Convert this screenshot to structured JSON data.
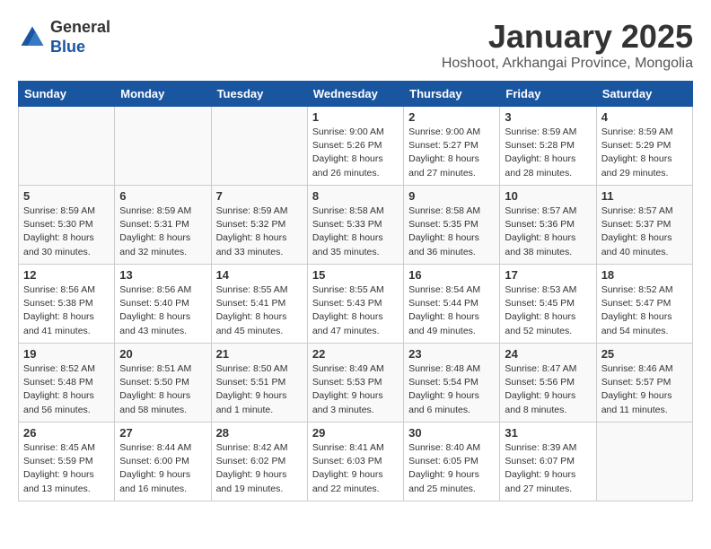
{
  "header": {
    "logo_line1": "General",
    "logo_line2": "Blue",
    "month": "January 2025",
    "location": "Hoshoot, Arkhangai Province, Mongolia"
  },
  "weekdays": [
    "Sunday",
    "Monday",
    "Tuesday",
    "Wednesday",
    "Thursday",
    "Friday",
    "Saturday"
  ],
  "weeks": [
    [
      {
        "day": "",
        "info": ""
      },
      {
        "day": "",
        "info": ""
      },
      {
        "day": "",
        "info": ""
      },
      {
        "day": "1",
        "info": "Sunrise: 9:00 AM\nSunset: 5:26 PM\nDaylight: 8 hours\nand 26 minutes."
      },
      {
        "day": "2",
        "info": "Sunrise: 9:00 AM\nSunset: 5:27 PM\nDaylight: 8 hours\nand 27 minutes."
      },
      {
        "day": "3",
        "info": "Sunrise: 8:59 AM\nSunset: 5:28 PM\nDaylight: 8 hours\nand 28 minutes."
      },
      {
        "day": "4",
        "info": "Sunrise: 8:59 AM\nSunset: 5:29 PM\nDaylight: 8 hours\nand 29 minutes."
      }
    ],
    [
      {
        "day": "5",
        "info": "Sunrise: 8:59 AM\nSunset: 5:30 PM\nDaylight: 8 hours\nand 30 minutes."
      },
      {
        "day": "6",
        "info": "Sunrise: 8:59 AM\nSunset: 5:31 PM\nDaylight: 8 hours\nand 32 minutes."
      },
      {
        "day": "7",
        "info": "Sunrise: 8:59 AM\nSunset: 5:32 PM\nDaylight: 8 hours\nand 33 minutes."
      },
      {
        "day": "8",
        "info": "Sunrise: 8:58 AM\nSunset: 5:33 PM\nDaylight: 8 hours\nand 35 minutes."
      },
      {
        "day": "9",
        "info": "Sunrise: 8:58 AM\nSunset: 5:35 PM\nDaylight: 8 hours\nand 36 minutes."
      },
      {
        "day": "10",
        "info": "Sunrise: 8:57 AM\nSunset: 5:36 PM\nDaylight: 8 hours\nand 38 minutes."
      },
      {
        "day": "11",
        "info": "Sunrise: 8:57 AM\nSunset: 5:37 PM\nDaylight: 8 hours\nand 40 minutes."
      }
    ],
    [
      {
        "day": "12",
        "info": "Sunrise: 8:56 AM\nSunset: 5:38 PM\nDaylight: 8 hours\nand 41 minutes."
      },
      {
        "day": "13",
        "info": "Sunrise: 8:56 AM\nSunset: 5:40 PM\nDaylight: 8 hours\nand 43 minutes."
      },
      {
        "day": "14",
        "info": "Sunrise: 8:55 AM\nSunset: 5:41 PM\nDaylight: 8 hours\nand 45 minutes."
      },
      {
        "day": "15",
        "info": "Sunrise: 8:55 AM\nSunset: 5:43 PM\nDaylight: 8 hours\nand 47 minutes."
      },
      {
        "day": "16",
        "info": "Sunrise: 8:54 AM\nSunset: 5:44 PM\nDaylight: 8 hours\nand 49 minutes."
      },
      {
        "day": "17",
        "info": "Sunrise: 8:53 AM\nSunset: 5:45 PM\nDaylight: 8 hours\nand 52 minutes."
      },
      {
        "day": "18",
        "info": "Sunrise: 8:52 AM\nSunset: 5:47 PM\nDaylight: 8 hours\nand 54 minutes."
      }
    ],
    [
      {
        "day": "19",
        "info": "Sunrise: 8:52 AM\nSunset: 5:48 PM\nDaylight: 8 hours\nand 56 minutes."
      },
      {
        "day": "20",
        "info": "Sunrise: 8:51 AM\nSunset: 5:50 PM\nDaylight: 8 hours\nand 58 minutes."
      },
      {
        "day": "21",
        "info": "Sunrise: 8:50 AM\nSunset: 5:51 PM\nDaylight: 9 hours\nand 1 minute."
      },
      {
        "day": "22",
        "info": "Sunrise: 8:49 AM\nSunset: 5:53 PM\nDaylight: 9 hours\nand 3 minutes."
      },
      {
        "day": "23",
        "info": "Sunrise: 8:48 AM\nSunset: 5:54 PM\nDaylight: 9 hours\nand 6 minutes."
      },
      {
        "day": "24",
        "info": "Sunrise: 8:47 AM\nSunset: 5:56 PM\nDaylight: 9 hours\nand 8 minutes."
      },
      {
        "day": "25",
        "info": "Sunrise: 8:46 AM\nSunset: 5:57 PM\nDaylight: 9 hours\nand 11 minutes."
      }
    ],
    [
      {
        "day": "26",
        "info": "Sunrise: 8:45 AM\nSunset: 5:59 PM\nDaylight: 9 hours\nand 13 minutes."
      },
      {
        "day": "27",
        "info": "Sunrise: 8:44 AM\nSunset: 6:00 PM\nDaylight: 9 hours\nand 16 minutes."
      },
      {
        "day": "28",
        "info": "Sunrise: 8:42 AM\nSunset: 6:02 PM\nDaylight: 9 hours\nand 19 minutes."
      },
      {
        "day": "29",
        "info": "Sunrise: 8:41 AM\nSunset: 6:03 PM\nDaylight: 9 hours\nand 22 minutes."
      },
      {
        "day": "30",
        "info": "Sunrise: 8:40 AM\nSunset: 6:05 PM\nDaylight: 9 hours\nand 25 minutes."
      },
      {
        "day": "31",
        "info": "Sunrise: 8:39 AM\nSunset: 6:07 PM\nDaylight: 9 hours\nand 27 minutes."
      },
      {
        "day": "",
        "info": ""
      }
    ]
  ]
}
